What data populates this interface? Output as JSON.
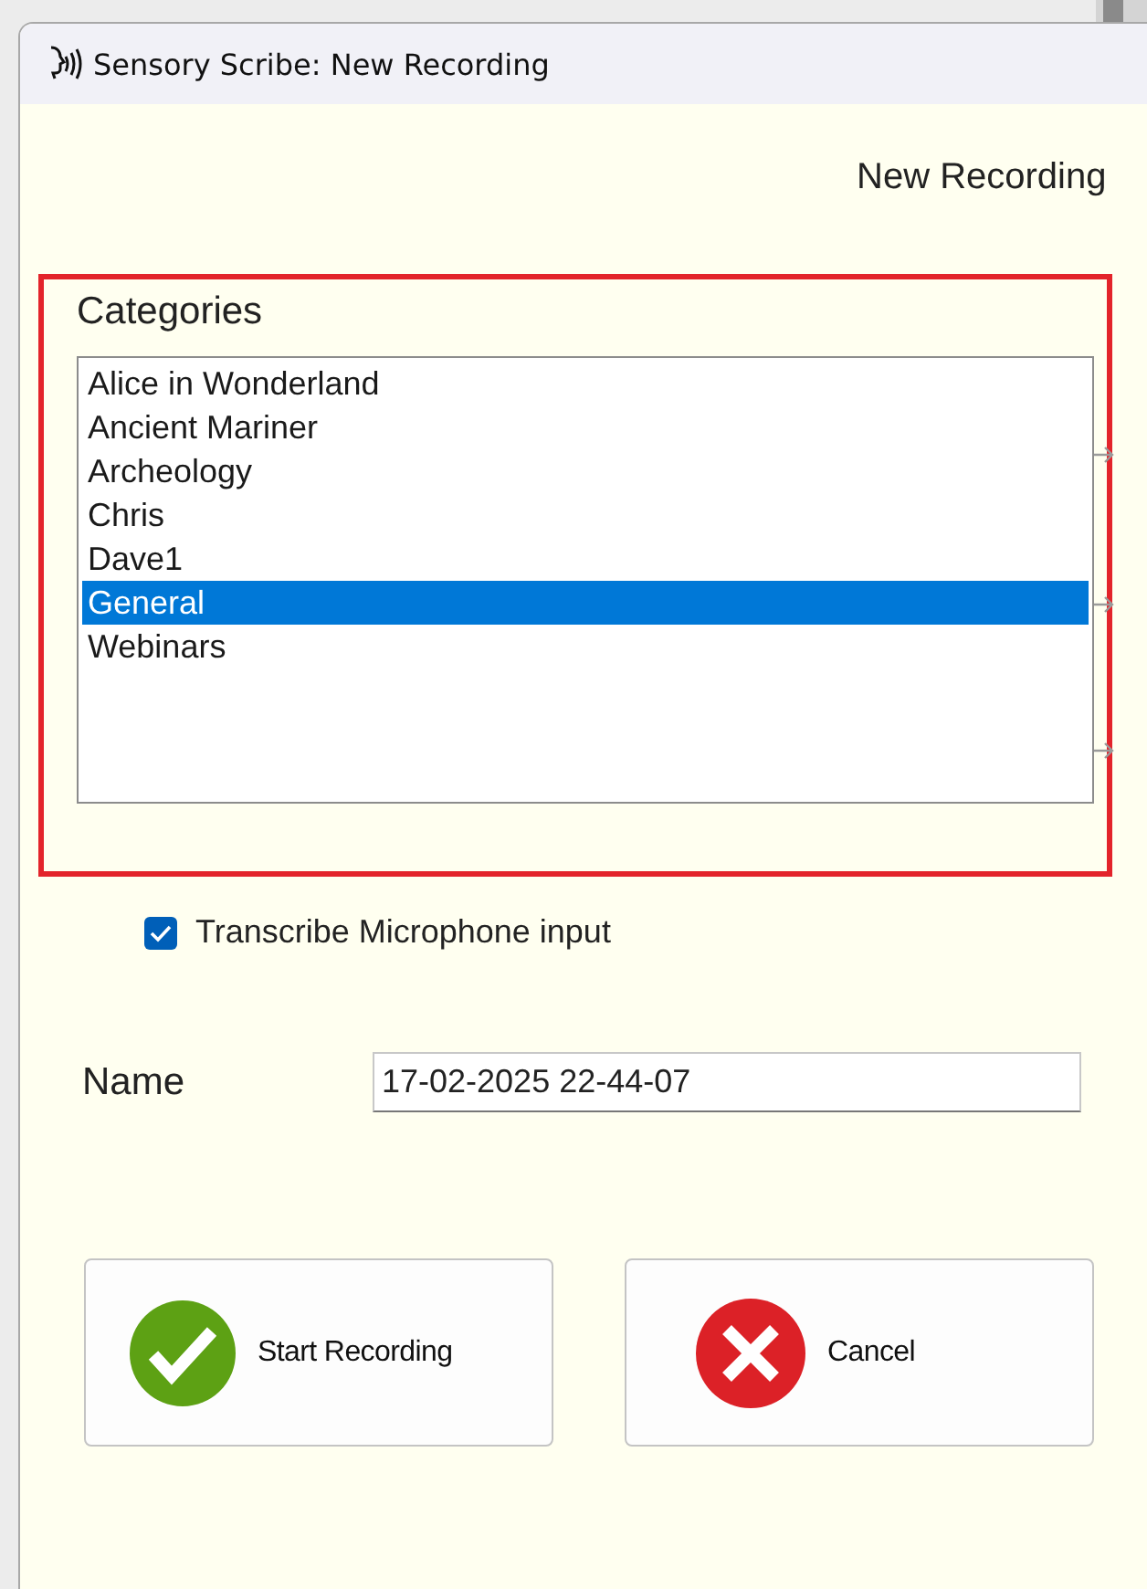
{
  "window": {
    "title": "Sensory Scribe: New Recording"
  },
  "heading": "New Recording",
  "categories": {
    "label": "Categories",
    "items": [
      {
        "label": "Alice in Wonderland",
        "selected": false
      },
      {
        "label": "Ancient Mariner",
        "selected": false
      },
      {
        "label": "Archeology",
        "selected": false
      },
      {
        "label": "Chris",
        "selected": false
      },
      {
        "label": "Dave1",
        "selected": false
      },
      {
        "label": "General",
        "selected": true
      },
      {
        "label": "Webinars",
        "selected": false
      }
    ]
  },
  "transcribe": {
    "label": "Transcribe Microphone input",
    "checked": true
  },
  "name": {
    "label": "Name",
    "value": "17-02-2025 22-44-07"
  },
  "buttons": [
    {
      "kind": "confirm",
      "label": "Start Recording"
    },
    {
      "kind": "cancel",
      "label": "Cancel"
    }
  ]
}
